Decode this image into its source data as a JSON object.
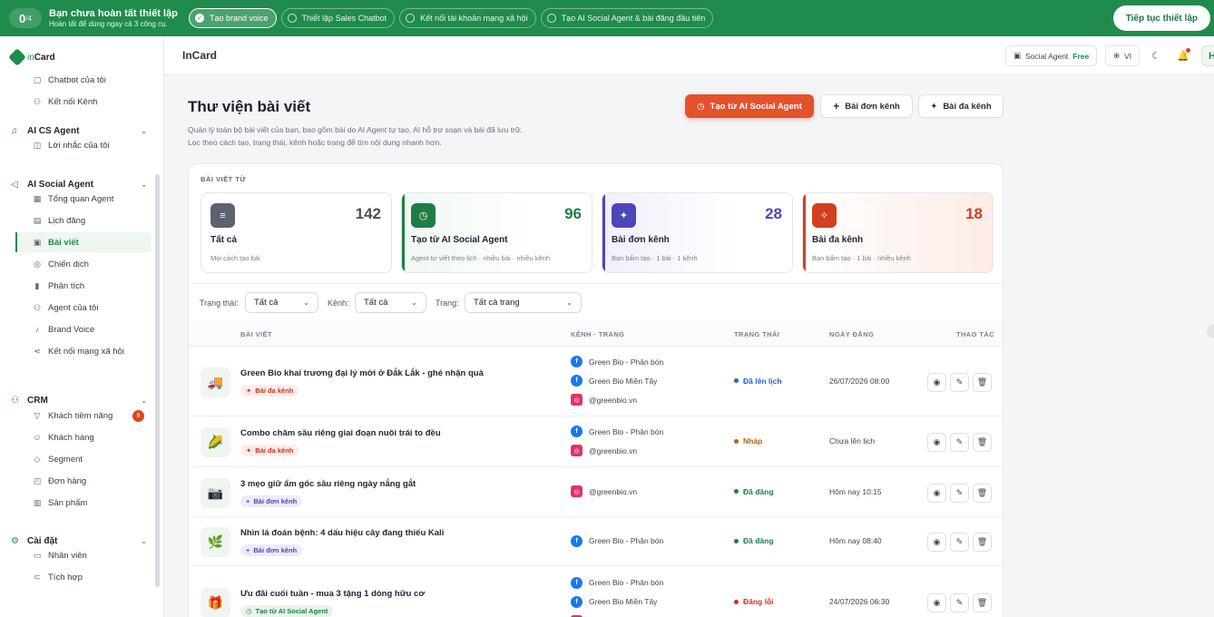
{
  "banner": {
    "progress_num": "0",
    "progress_den": "/4",
    "title": "Bạn chưa hoàn tất thiết lập",
    "subtitle": "Hoàn tất để dùng ngay cả 3 công cụ.",
    "steps": [
      {
        "label": "Tạo brand voice",
        "active": true
      },
      {
        "label": "Thiết lập Sales Chatbot",
        "active": false
      },
      {
        "label": "Kết nối tài khoản mạng xã hội",
        "active": false
      },
      {
        "label": "Tạo AI Social Agent & bài đăng đầu tiên",
        "active": false
      }
    ],
    "continue_label": "Tiếp tục thiết lập"
  },
  "sidebar": {
    "logo_in": "in",
    "logo_card": "Card",
    "items_top": [
      {
        "label": "Chatbot của tôi",
        "icon": "chat-icon"
      },
      {
        "label": "Kết nối Kênh",
        "icon": "connect-icon"
      }
    ],
    "sections": [
      {
        "label": "AI CS Agent",
        "items": [
          {
            "label": "Lời nhắc của tôi"
          }
        ]
      },
      {
        "label": "AI Social Agent",
        "items": [
          {
            "label": "Tổng quan Agent"
          },
          {
            "label": "Lịch đăng"
          },
          {
            "label": "Bài viết",
            "active": true
          },
          {
            "label": "Chiến dịch"
          },
          {
            "label": "Phân tích"
          },
          {
            "label": "Agent của tôi"
          },
          {
            "label": "Brand Voice"
          },
          {
            "label": "Kết nối mạng xã hội"
          }
        ]
      },
      {
        "label": "CRM",
        "items": [
          {
            "label": "Khách tiềm năng",
            "badge": "9"
          },
          {
            "label": "Khách hàng"
          },
          {
            "label": "Segment"
          },
          {
            "label": "Đơn hàng"
          },
          {
            "label": "Sản phẩm"
          }
        ]
      },
      {
        "label": "Cài đặt",
        "items": [
          {
            "label": "Nhân viên"
          },
          {
            "label": "Tích hợp"
          }
        ]
      }
    ]
  },
  "header": {
    "title": "InCard",
    "social_agent_label": "Social Agent",
    "plan": "Free",
    "lang": "VI",
    "user_initial": "H"
  },
  "page": {
    "title": "Thư viện bài viết",
    "desc1": "Quản lý toàn bộ bài viết của bạn, bao gồm bài do AI Agent tự tạo, AI hỗ trợ soạn và bài đã lưu trữ.",
    "desc2": "Lọc theo cách tạo, trạng thái, kênh hoặc trang để tìm nội dung nhanh hơn.",
    "btn_ai": "Tạo từ AI Social Agent",
    "btn_single": "Bài đơn kênh",
    "btn_multi": "Bài đa kênh"
  },
  "stats_label": "BÀI VIẾT TỪ",
  "stats": [
    {
      "name": "Tất cả",
      "count": "142",
      "desc": "Mọi cách tạo bài",
      "color": "#5b6270",
      "num_color": "#4a4f5a",
      "icon": "list-icon"
    },
    {
      "name": "Tạo từ AI Social Agent",
      "count": "96",
      "desc": "Agent tự viết theo lịch · nhiều bài · nhiều kênh",
      "color": "#1e7d44",
      "num_color": "#1e7d44",
      "icon": "clock-icon"
    },
    {
      "name": "Bài đơn kênh",
      "count": "28",
      "desc": "Bạn bấm tạo · 1 bài · 1 kênh",
      "color": "#4b47b8",
      "num_color": "#4b47b8",
      "icon": "sparkle-icon"
    },
    {
      "name": "Bài đa kênh",
      "count": "18",
      "desc": "Bạn bấm tạo · 1 bài · nhiều kênh",
      "color": "#d1401f",
      "num_color": "#d1401f",
      "icon": "sparkles-icon"
    }
  ],
  "filters": {
    "status_label": "Trạng thái:",
    "status_value": "Tất cả",
    "channel_label": "Kênh:",
    "channel_value": "Tất cả",
    "page_label": "Trang:",
    "page_value": "Tất cả trang"
  },
  "table": {
    "headers": [
      "BÀI VIẾT",
      "KÊNH · TRANG",
      "TRẠNG THÁI",
      "NGÀY ĐĂNG",
      "THAO TÁC"
    ],
    "rows": [
      {
        "title": "Green Bio khai trương đại lý mới ở Đắk Lắk - ghé nhận quà",
        "tag": "Bài đa kênh",
        "tag_type": "multi",
        "thumb": "🚚",
        "thumb_bg": "#eef6ef",
        "channels": [
          {
            "type": "fb",
            "name": "Green Bio - Phân bón"
          },
          {
            "type": "fb",
            "name": "Green Bio Miền Tây"
          },
          {
            "type": "ig",
            "name": "@greenbio.vn"
          }
        ],
        "status": "Đã lên lịch",
        "status_color": "#2563c9",
        "date": "26/07/2026 08:00"
      },
      {
        "title": "Combo chăm sầu riêng giai đoạn nuôi trái to đều",
        "tag": "Bài đa kênh",
        "tag_type": "multi",
        "thumb": "🌽",
        "thumb_bg": "#eef6ef",
        "channels": [
          {
            "type": "fb",
            "name": "Green Bio - Phân bón"
          },
          {
            "type": "ig",
            "name": "@greenbio.vn"
          }
        ],
        "status": "Nháp",
        "status_color": "#a7661b",
        "date": "Chưa lên lịch"
      },
      {
        "title": "3 mẹo giữ ẩm gốc sầu riêng ngày nắng gắt",
        "tag": "Bài đơn kênh",
        "tag_type": "single",
        "thumb": "📷",
        "thumb_bg": "#eef6ef",
        "channels": [
          {
            "type": "ig",
            "name": "@greenbio.vn"
          }
        ],
        "status": "Đã đăng",
        "status_color": "#1e7d44",
        "date": "Hôm nay 10:15"
      },
      {
        "title": "Nhìn lá đoán bệnh: 4 dấu hiệu cây đang thiếu Kali",
        "tag": "Bài đơn kênh",
        "tag_type": "single",
        "thumb": "🌿",
        "thumb_bg": "#eef6ef",
        "channels": [
          {
            "type": "fb",
            "name": "Green Bio - Phân bón"
          }
        ],
        "status": "Đã đăng",
        "status_color": "#1e7d44",
        "date": "Hôm nay 08:40"
      },
      {
        "title": "Ưu đãi cuối tuần - mua 3 tặng 1 dòng hữu cơ",
        "tag": "Tạo từ AI Social Agent",
        "tag_type": "ai",
        "thumb": "🎁",
        "thumb_bg": "#eef6ef",
        "channels": [
          {
            "type": "fb",
            "name": "Green Bio - Phân bón"
          },
          {
            "type": "fb",
            "name": "Green Bio Miền Tây"
          },
          {
            "type": "ig",
            "name": "@greenbio.vn"
          }
        ],
        "status": "Đăng lỗi",
        "status_color": "#d1301f",
        "date": "24/07/2026 06:30"
      }
    ]
  }
}
